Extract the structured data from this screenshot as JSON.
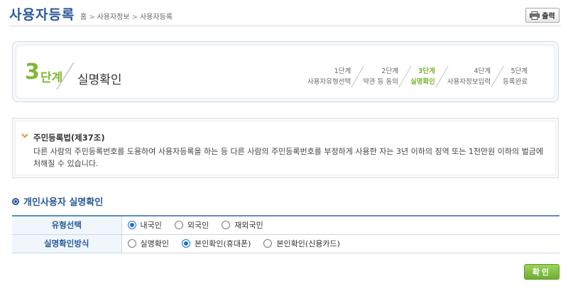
{
  "header": {
    "title": "사용자등록",
    "breadcrumb": [
      "홈",
      "사용자정보",
      "사용자등록"
    ],
    "breadcrumb_separator": ">",
    "print_label": "출력"
  },
  "step_box": {
    "current_number": "3",
    "current_unit": "단계",
    "current_title": "실명확인",
    "steps": [
      {
        "number": "1단계",
        "label": "사용자유형선택",
        "active": false
      },
      {
        "number": "2단계",
        "label": "약관 등 동의",
        "active": false
      },
      {
        "number": "3단계",
        "label": "실명확인",
        "active": true
      },
      {
        "number": "4단계",
        "label": "사용자정보입력",
        "active": false
      },
      {
        "number": "5단계",
        "label": "등록완료",
        "active": false
      }
    ]
  },
  "notice": {
    "title": "주민등록법(제37조)",
    "text": "다른 사람의 주민등록번호를 도용하여 사용자등록을 하는 등 다른 사람의 주민등록번호를 부정하게 사용한 자는 3년 이하의 징역 또는 1천만원 이하의 벌금에 처해질 수 있습니다."
  },
  "section": {
    "title": "개인사용자 실명확인"
  },
  "form": {
    "rows": [
      {
        "label": "유형선택",
        "options": [
          {
            "label": "내국인",
            "checked": true
          },
          {
            "label": "외국인",
            "checked": false
          },
          {
            "label": "재외국민",
            "checked": false
          }
        ]
      },
      {
        "label": "실명확인방식",
        "options": [
          {
            "label": "실명확인",
            "checked": false
          },
          {
            "label": "본인확인(휴대폰)",
            "checked": true
          },
          {
            "label": "본인확인(신용카드)",
            "checked": false
          }
        ]
      }
    ]
  },
  "confirm_label": "확인",
  "colors": {
    "brand_blue": "#2a5a9a",
    "step_green": "#7fb833",
    "radio_blue": "#1a6fd0",
    "notice_chevron": "#e8912c"
  }
}
